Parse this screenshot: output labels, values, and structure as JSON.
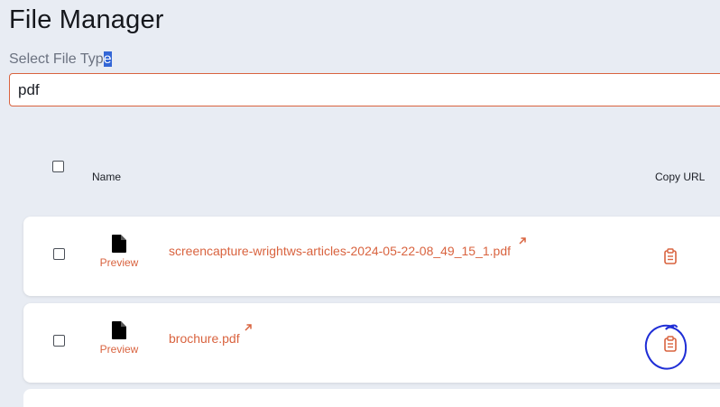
{
  "page": {
    "title": "File Manager"
  },
  "filter": {
    "label_before_selection": "Select File Typ",
    "label_selected": "e",
    "value": "pdf"
  },
  "table": {
    "columns": {
      "name": "Name",
      "copy_url": "Copy URL"
    },
    "rows": [
      {
        "preview_label": "Preview",
        "file_name": "screencapture-wrightws-articles-2024-05-22-08_49_15_1.pdf",
        "checked": false
      },
      {
        "preview_label": "Preview",
        "file_name": "brochure.pdf",
        "checked": false
      }
    ]
  },
  "colors": {
    "accent": "#d9633f",
    "background": "#e8ecf3",
    "annotation": "#1f2ed6"
  },
  "icons": {
    "file": "file-icon",
    "external": "external-link-icon",
    "copy": "clipboard-icon"
  }
}
